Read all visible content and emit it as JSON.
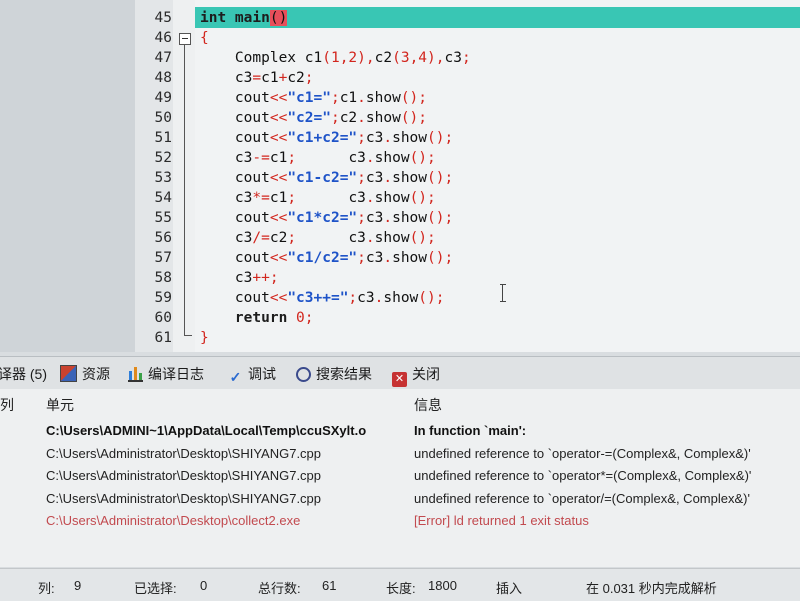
{
  "editor": {
    "lines": [
      {
        "num": "45",
        "active": true,
        "tokens": [
          {
            "t": "int ",
            "c": "kw"
          },
          {
            "t": "main",
            "c": "kw"
          },
          {
            "t": "()",
            "c": "paren-hl"
          }
        ]
      },
      {
        "num": "46",
        "tokens": [
          {
            "t": "{",
            "c": "op"
          }
        ]
      },
      {
        "num": "47",
        "tokens": [
          {
            "t": "    Complex c1"
          },
          {
            "t": "(",
            "c": "op"
          },
          {
            "t": "1",
            "c": "num"
          },
          {
            "t": ",",
            "c": "op"
          },
          {
            "t": "2",
            "c": "num"
          },
          {
            "t": "),",
            "c": "op"
          },
          {
            "t": "c2"
          },
          {
            "t": "(",
            "c": "op"
          },
          {
            "t": "3",
            "c": "num"
          },
          {
            "t": ",",
            "c": "op"
          },
          {
            "t": "4",
            "c": "num"
          },
          {
            "t": "),",
            "c": "op"
          },
          {
            "t": "c3"
          },
          {
            "t": ";",
            "c": "op"
          }
        ]
      },
      {
        "num": "48",
        "tokens": [
          {
            "t": "    c3"
          },
          {
            "t": "=",
            "c": "op"
          },
          {
            "t": "c1"
          },
          {
            "t": "+",
            "c": "op"
          },
          {
            "t": "c2"
          },
          {
            "t": ";",
            "c": "op"
          }
        ]
      },
      {
        "num": "49",
        "tokens": [
          {
            "t": "    cout"
          },
          {
            "t": "<<",
            "c": "op"
          },
          {
            "t": "\"c1=\"",
            "c": "str"
          },
          {
            "t": ";",
            "c": "op"
          },
          {
            "t": "c1"
          },
          {
            "t": ".",
            "c": "op"
          },
          {
            "t": "show"
          },
          {
            "t": "();",
            "c": "op"
          }
        ]
      },
      {
        "num": "50",
        "tokens": [
          {
            "t": "    cout"
          },
          {
            "t": "<<",
            "c": "op"
          },
          {
            "t": "\"c2=\"",
            "c": "str"
          },
          {
            "t": ";",
            "c": "op"
          },
          {
            "t": "c2"
          },
          {
            "t": ".",
            "c": "op"
          },
          {
            "t": "show"
          },
          {
            "t": "();",
            "c": "op"
          }
        ]
      },
      {
        "num": "51",
        "tokens": [
          {
            "t": "    cout"
          },
          {
            "t": "<<",
            "c": "op"
          },
          {
            "t": "\"c1+c2=\"",
            "c": "str"
          },
          {
            "t": ";",
            "c": "op"
          },
          {
            "t": "c3"
          },
          {
            "t": ".",
            "c": "op"
          },
          {
            "t": "show"
          },
          {
            "t": "();",
            "c": "op"
          }
        ]
      },
      {
        "num": "52",
        "tokens": [
          {
            "t": "    c3"
          },
          {
            "t": "-=",
            "c": "op"
          },
          {
            "t": "c1"
          },
          {
            "t": ";",
            "c": "op"
          },
          {
            "t": "      c3"
          },
          {
            "t": ".",
            "c": "op"
          },
          {
            "t": "show"
          },
          {
            "t": "();",
            "c": "op"
          }
        ]
      },
      {
        "num": "53",
        "tokens": [
          {
            "t": "    cout"
          },
          {
            "t": "<<",
            "c": "op"
          },
          {
            "t": "\"c1-c2=\"",
            "c": "str"
          },
          {
            "t": ";",
            "c": "op"
          },
          {
            "t": "c3"
          },
          {
            "t": ".",
            "c": "op"
          },
          {
            "t": "show"
          },
          {
            "t": "();",
            "c": "op"
          }
        ]
      },
      {
        "num": "54",
        "tokens": [
          {
            "t": "    c3"
          },
          {
            "t": "*=",
            "c": "op"
          },
          {
            "t": "c1"
          },
          {
            "t": ";",
            "c": "op"
          },
          {
            "t": "      c3"
          },
          {
            "t": ".",
            "c": "op"
          },
          {
            "t": "show"
          },
          {
            "t": "();",
            "c": "op"
          }
        ]
      },
      {
        "num": "55",
        "tokens": [
          {
            "t": "    cout"
          },
          {
            "t": "<<",
            "c": "op"
          },
          {
            "t": "\"c1*c2=\"",
            "c": "str"
          },
          {
            "t": ";",
            "c": "op"
          },
          {
            "t": "c3"
          },
          {
            "t": ".",
            "c": "op"
          },
          {
            "t": "show"
          },
          {
            "t": "();",
            "c": "op"
          }
        ]
      },
      {
        "num": "56",
        "tokens": [
          {
            "t": "    c3"
          },
          {
            "t": "/=",
            "c": "op"
          },
          {
            "t": "c2"
          },
          {
            "t": ";",
            "c": "op"
          },
          {
            "t": "      c3"
          },
          {
            "t": ".",
            "c": "op"
          },
          {
            "t": "show"
          },
          {
            "t": "();",
            "c": "op"
          }
        ]
      },
      {
        "num": "57",
        "tokens": [
          {
            "t": "    cout"
          },
          {
            "t": "<<",
            "c": "op"
          },
          {
            "t": "\"c1/c2=\"",
            "c": "str"
          },
          {
            "t": ";",
            "c": "op"
          },
          {
            "t": "c3"
          },
          {
            "t": ".",
            "c": "op"
          },
          {
            "t": "show"
          },
          {
            "t": "();",
            "c": "op"
          }
        ]
      },
      {
        "num": "58",
        "tokens": [
          {
            "t": "    c3"
          },
          {
            "t": "++;",
            "c": "op"
          }
        ]
      },
      {
        "num": "59",
        "tokens": [
          {
            "t": "    cout"
          },
          {
            "t": "<<",
            "c": "op"
          },
          {
            "t": "\"c3++=\"",
            "c": "str"
          },
          {
            "t": ";",
            "c": "op"
          },
          {
            "t": "c3"
          },
          {
            "t": ".",
            "c": "op"
          },
          {
            "t": "show"
          },
          {
            "t": "();",
            "c": "op"
          }
        ]
      },
      {
        "num": "60",
        "tokens": [
          {
            "t": "    "
          },
          {
            "t": "return ",
            "c": "kw"
          },
          {
            "t": "0",
            "c": "num"
          },
          {
            "t": ";",
            "c": "op"
          }
        ]
      },
      {
        "num": "61",
        "tokens": [
          {
            "t": "}",
            "c": "op"
          }
        ]
      }
    ]
  },
  "tabs": {
    "compiler": "译器 (5)",
    "resources": "资源",
    "compile_log": "编译日志",
    "debug": "调试",
    "search_results": "搜索结果",
    "close": "关闭"
  },
  "log": {
    "headers": {
      "col": "列",
      "unit": "单元",
      "message": "信息"
    },
    "rows": [
      {
        "unit": "C:\\Users\\ADMINI~1\\AppData\\Local\\Temp\\ccuSXylt.o",
        "message": "In function `main':",
        "style": "bold"
      },
      {
        "unit": "C:\\Users\\Administrator\\Desktop\\SHIYANG7.cpp",
        "message": "undefined reference to `operator-=(Complex&, Complex&)'",
        "style": ""
      },
      {
        "unit": "C:\\Users\\Administrator\\Desktop\\SHIYANG7.cpp",
        "message": "undefined reference to `operator*=(Complex&, Complex&)'",
        "style": ""
      },
      {
        "unit": "C:\\Users\\Administrator\\Desktop\\SHIYANG7.cpp",
        "message": "undefined reference to `operator/=(Complex&, Complex&)'",
        "style": ""
      },
      {
        "unit": "C:\\Users\\Administrator\\Desktop\\collect2.exe",
        "message": "[Error] ld returned 1 exit status",
        "style": "err"
      }
    ]
  },
  "status": {
    "col_label": "列:",
    "col_value": "9",
    "sel_label": "已选择:",
    "sel_value": "0",
    "lines_label": "总行数:",
    "lines_value": "61",
    "len_label": "长度:",
    "len_value": "1800",
    "mode": "插入",
    "parse_time": "在 0.031 秒内完成解析"
  }
}
